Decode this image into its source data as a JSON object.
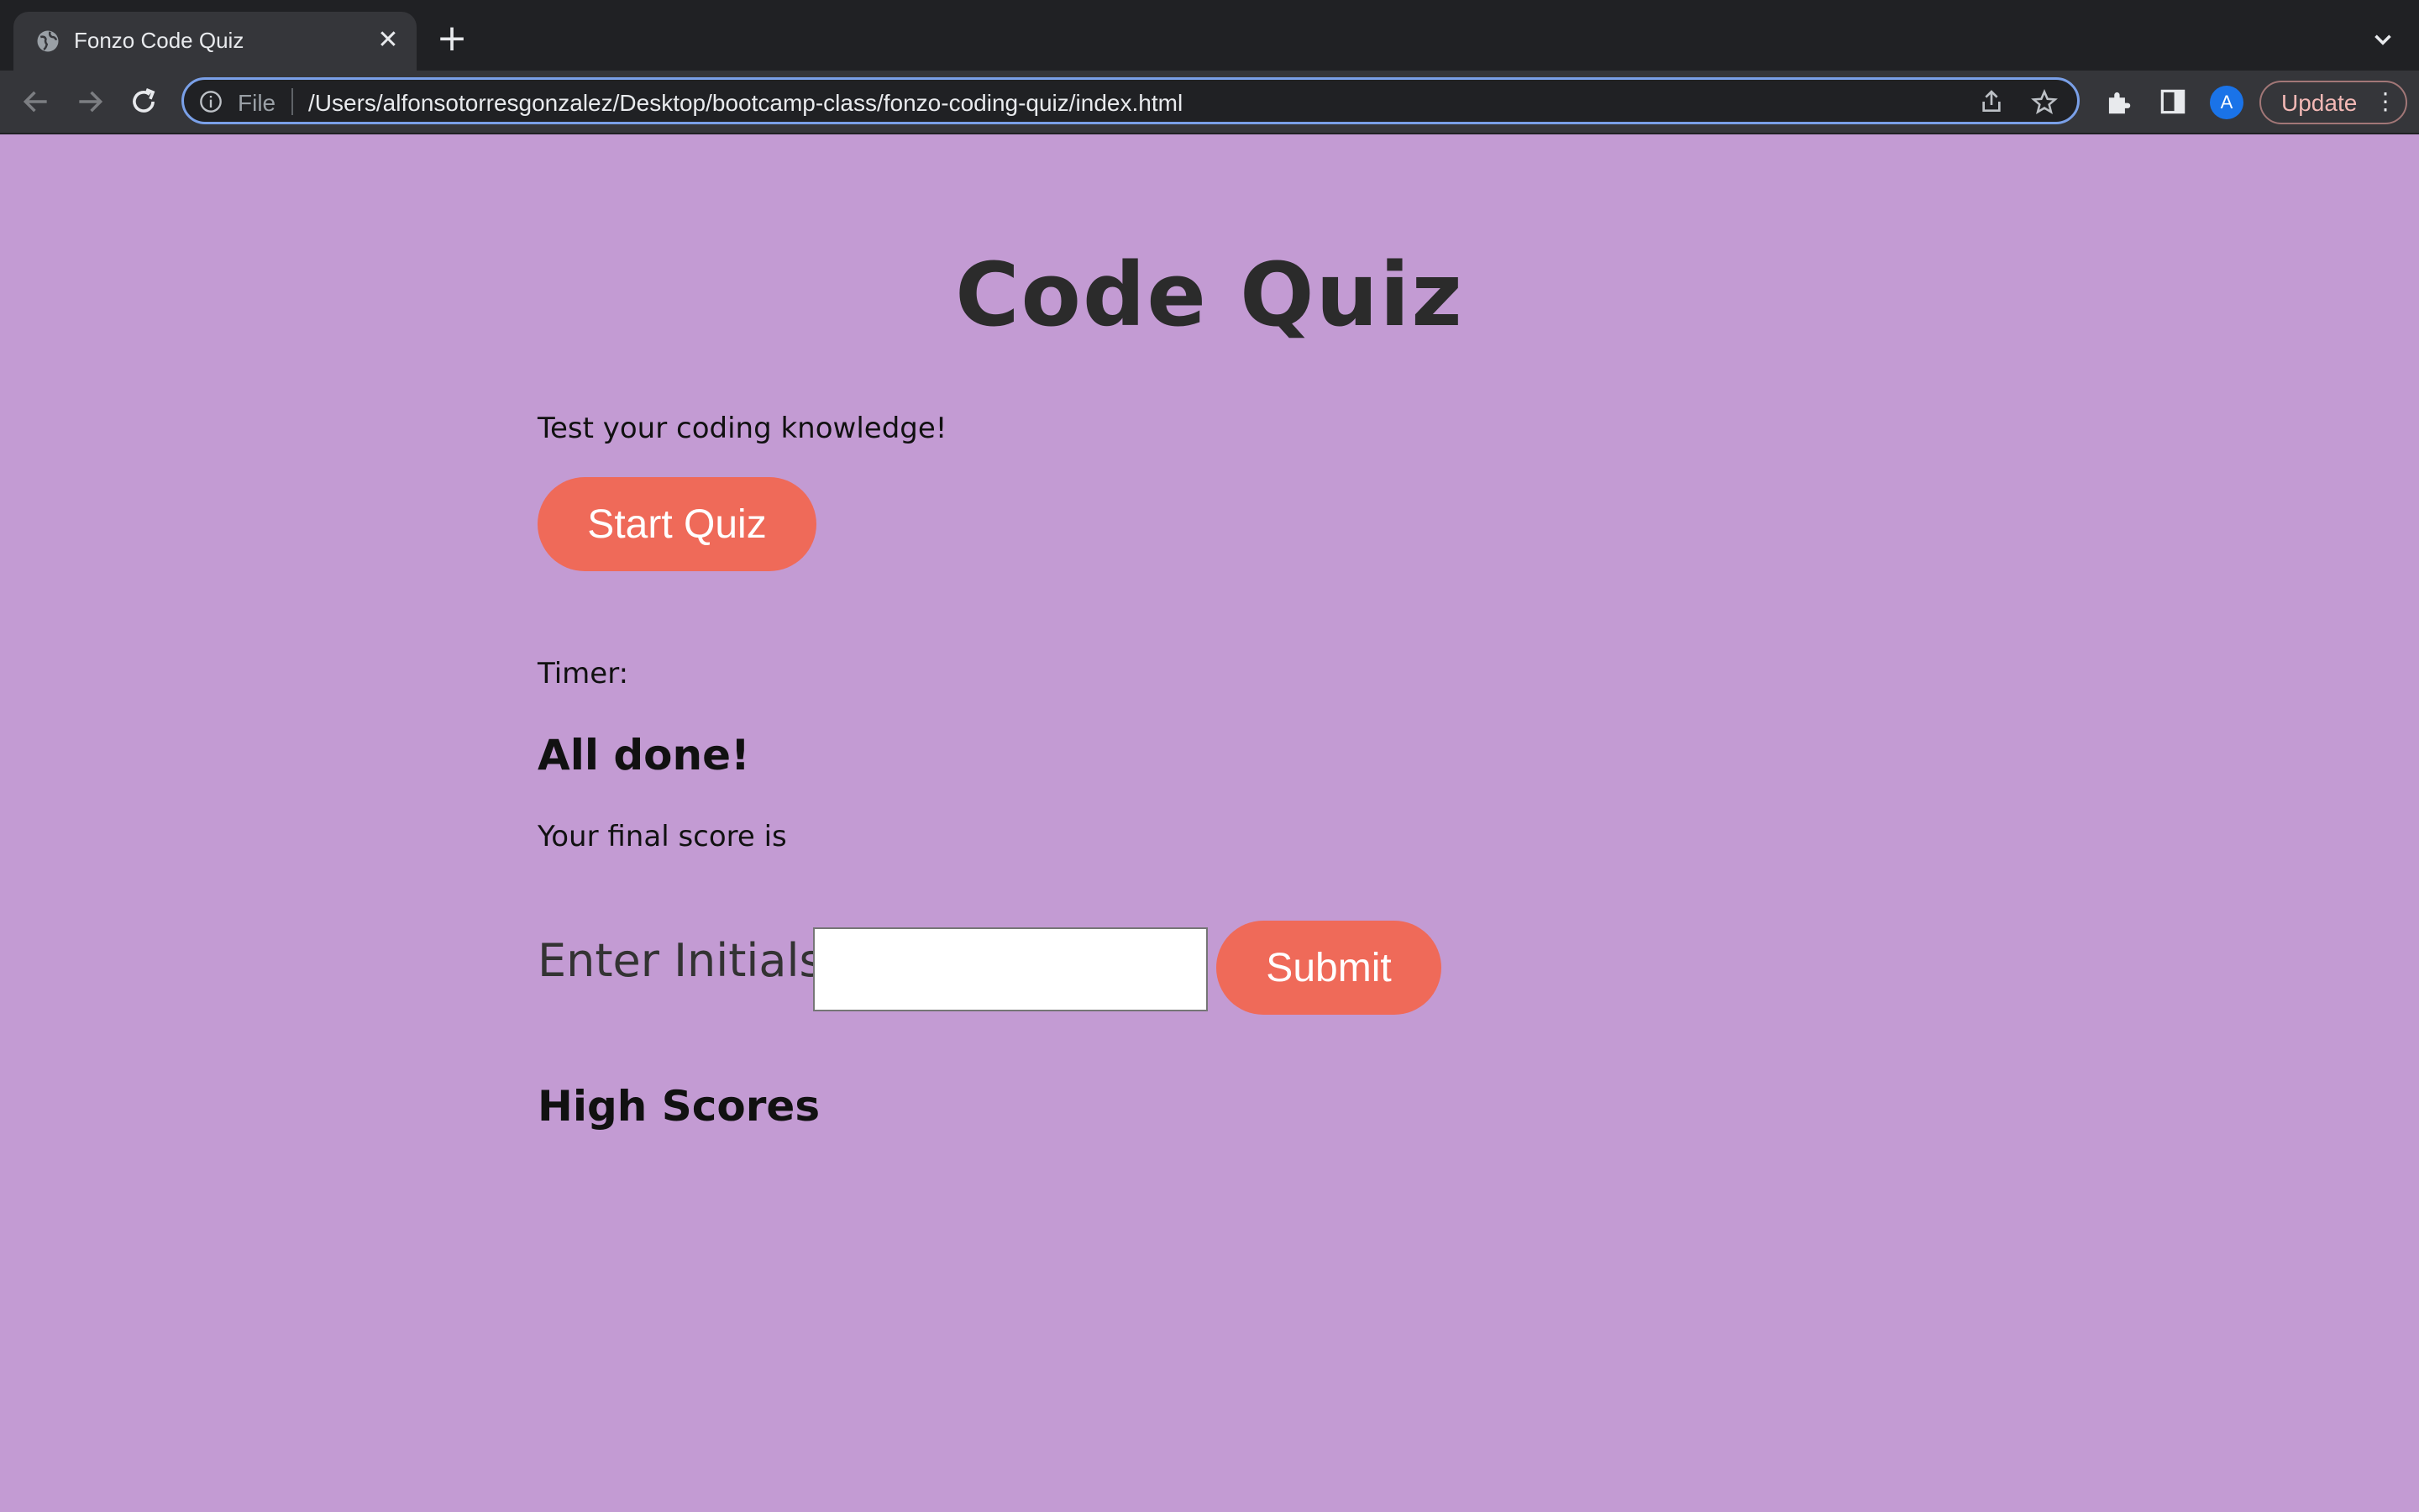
{
  "browser": {
    "tab_title": "Fonzo Code Quiz",
    "tab_close": "✕",
    "new_tab": "+",
    "address_scheme": "File",
    "address_url": "/Users/alfonsotorresgonzalez/Desktop/bootcamp-class/fonzo-coding-quiz/index.html",
    "profile_initial": "A",
    "update_label": "Update",
    "menu_glyph": "⋮",
    "icons": [
      "globe-icon",
      "close-icon",
      "plus-icon",
      "chevron-down-icon",
      "back-icon",
      "forward-icon",
      "reload-icon",
      "info-icon",
      "share-icon",
      "star-icon",
      "extensions-icon",
      "side-panel-icon"
    ],
    "accent_color": "#7aa0e8"
  },
  "page": {
    "title": "Code Quiz",
    "intro": "Test your coding knowledge!",
    "start_button": "Start Quiz",
    "timer_label": "Timer:",
    "done_heading": "All done!",
    "final_score_text": "Your final score is",
    "initials_label": "Enter Initials:",
    "initials_value": "",
    "submit_button": "Submit",
    "high_scores_heading": "High Scores",
    "background_color": "#c39bd3",
    "button_color": "#ef6a59"
  }
}
